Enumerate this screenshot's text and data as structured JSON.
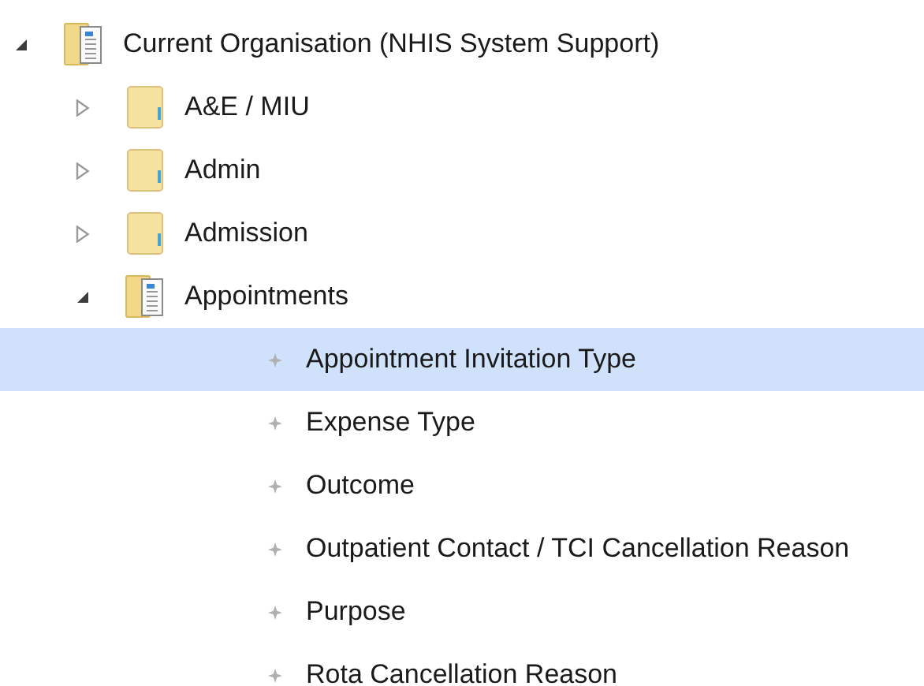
{
  "tree": [
    {
      "label": "Current Organisation (NHIS System Support)",
      "kind": "document-folder",
      "expanded": true,
      "selected": false,
      "children": [
        {
          "label": "A&E / MIU",
          "kind": "folder",
          "expanded": false,
          "selected": false
        },
        {
          "label": "Admin",
          "kind": "folder",
          "expanded": false,
          "selected": false
        },
        {
          "label": "Admission",
          "kind": "folder",
          "expanded": false,
          "selected": false
        },
        {
          "label": "Appointments",
          "kind": "document-folder",
          "expanded": true,
          "selected": false,
          "children": [
            {
              "label": "Appointment Invitation Type",
              "kind": "item",
              "selected": true
            },
            {
              "label": "Expense Type",
              "kind": "item",
              "selected": false
            },
            {
              "label": "Outcome",
              "kind": "item",
              "selected": false
            },
            {
              "label": "Outpatient Contact / TCI Cancellation Reason",
              "kind": "item",
              "selected": false
            },
            {
              "label": "Purpose",
              "kind": "item",
              "selected": false
            },
            {
              "label": "Rota Cancellation Reason",
              "kind": "item",
              "selected": false
            }
          ]
        }
      ]
    }
  ]
}
